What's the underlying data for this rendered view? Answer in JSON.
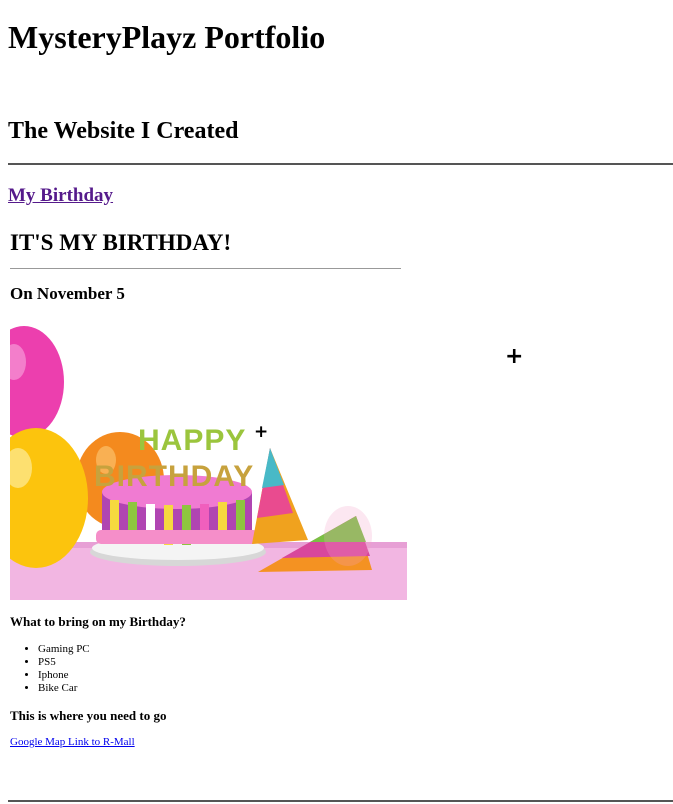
{
  "header": {
    "title": "MysteryPlayz Portfolio",
    "subtitle": "The Website I Created"
  },
  "project": {
    "link_label": "My Birthday",
    "heading": "IT'S MY BIRTHDAY!",
    "date": "On November 5",
    "image": {
      "description_icon": "birthday-cake-image",
      "candle_text": "HAPPY BIRTHDAY"
    },
    "bring_heading": "What to bring on my Birthday?",
    "bring_items": [
      "Gaming PC",
      "PS5",
      "Iphone",
      "Bike Car"
    ],
    "location_heading": "This is where you need to go",
    "map_link_label": "Google Map Link to R-Mall"
  },
  "colors": {
    "visited_link": "#551a8b",
    "link": "#0000ee",
    "rule": "#555555"
  },
  "icons": {
    "cursor": "crosshair-cursor-icon"
  }
}
